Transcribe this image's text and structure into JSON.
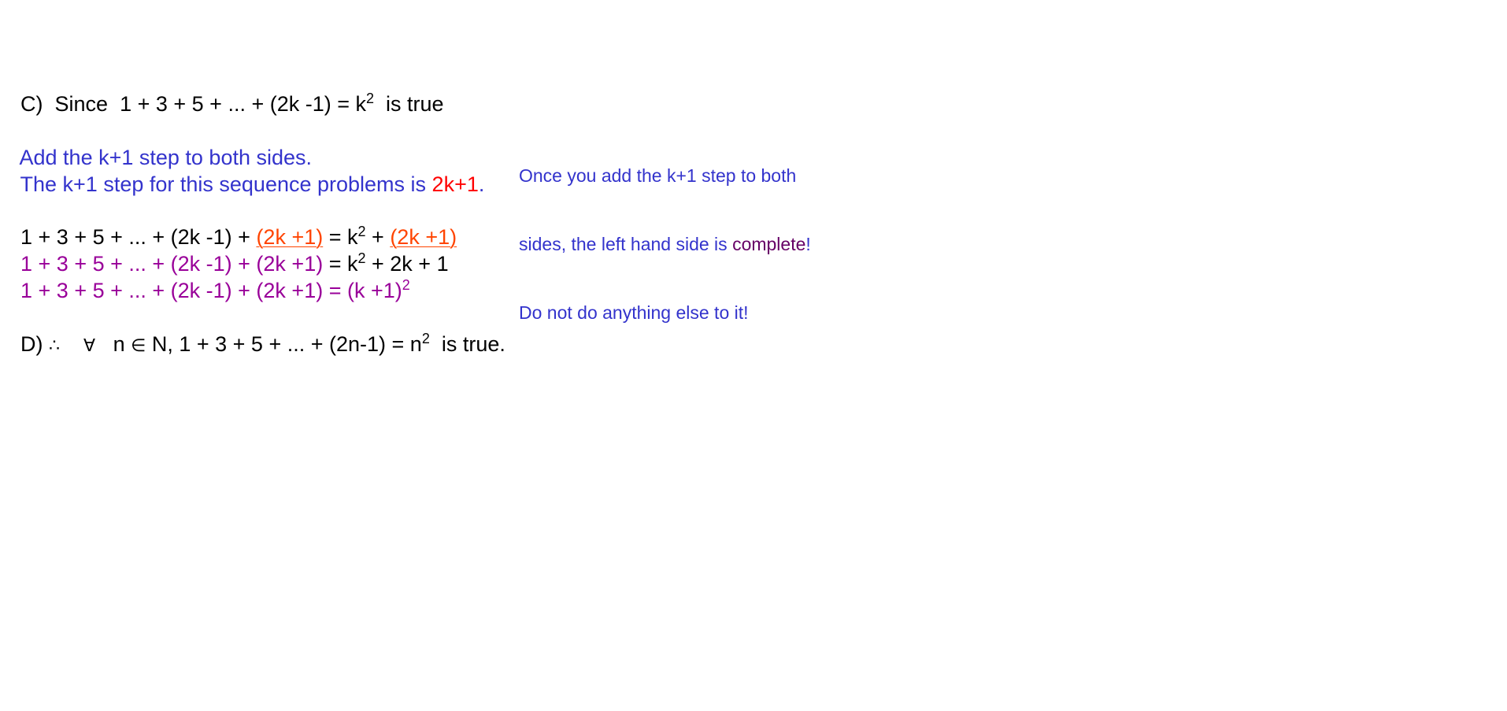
{
  "step_c": {
    "label": "C)",
    "since": "Since",
    "lhs": "1 + 3 + 5 + ... + (2k -1) = k",
    "exp": "2",
    "tail": "is true"
  },
  "instruction": {
    "line1": "Add the k+1 step to both sides.",
    "line2_prefix": "The k+1 step for this sequence problems is ",
    "line2_value": "2k+1",
    "line2_suffix": "."
  },
  "note": {
    "line1": "Once you add the k+1 step to both",
    "line2_prefix": "sides, the left hand side is ",
    "line2_highlight": "complete",
    "line2_suffix": "!",
    "line3": "Do not do anything else to it!"
  },
  "eq1": {
    "left": "1 + 3 + 5 + ... + (2k -1) + ",
    "added": "(2k +1)",
    "mid": " = k",
    "exp": "2",
    "plus": " + ",
    "added_rhs": "(2k +1)"
  },
  "eq2": {
    "left": "1 + 3 + 5 + ... + (2k -1) + (2k +1)",
    "right_a": " = k",
    "exp": "2",
    "right_b": " + 2k + 1"
  },
  "eq3": {
    "text": "1 + 3 + 5 + ... + (2k -1) + (2k +1) = (k +1)",
    "exp": "2"
  },
  "step_d": {
    "label": "D)",
    "therefore": "∴",
    "forall": "∀",
    "var": "n",
    "in": "∈",
    "set": "N",
    "stmt": ", 1 + 3 + 5 + ... + (2n-1) = n",
    "exp": "2",
    "tail": "is true."
  }
}
